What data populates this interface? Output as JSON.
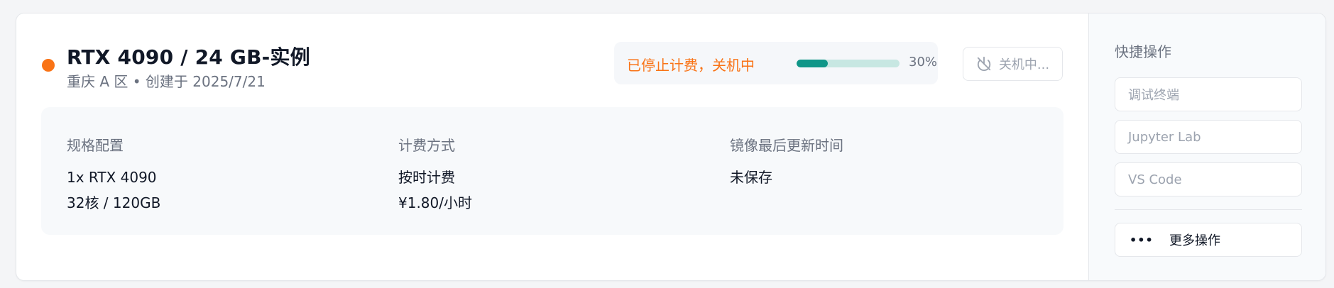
{
  "instance": {
    "title": "RTX 4090 / 24 GB-实例",
    "subtitle": "重庆 A 区 • 创建于 2025/7/21",
    "status_color": "#f97316"
  },
  "status": {
    "text": "已停止计费，关机中",
    "progress_percent": 30,
    "progress_label": "30%",
    "progress_fill_color": "#0f9688",
    "progress_track_color": "#c7e7e2"
  },
  "shutdown_button": {
    "label": "关机中...",
    "icon": "power-off-icon"
  },
  "info": {
    "spec": {
      "label": "规格配置",
      "values": [
        "1x RTX 4090",
        "32核 / 120GB"
      ]
    },
    "billing": {
      "label": "计费方式",
      "values": [
        "按时计费",
        "¥1.80/小时"
      ]
    },
    "image": {
      "label": "镜像最后更新时间",
      "values": [
        "未保存"
      ]
    }
  },
  "quick_actions": {
    "title": "快捷操作",
    "items": [
      {
        "label": "调试终端"
      },
      {
        "label": "Jupyter Lab"
      },
      {
        "label": "VS Code"
      }
    ],
    "more": {
      "label": "更多操作",
      "icon": "more-dots-icon"
    }
  }
}
